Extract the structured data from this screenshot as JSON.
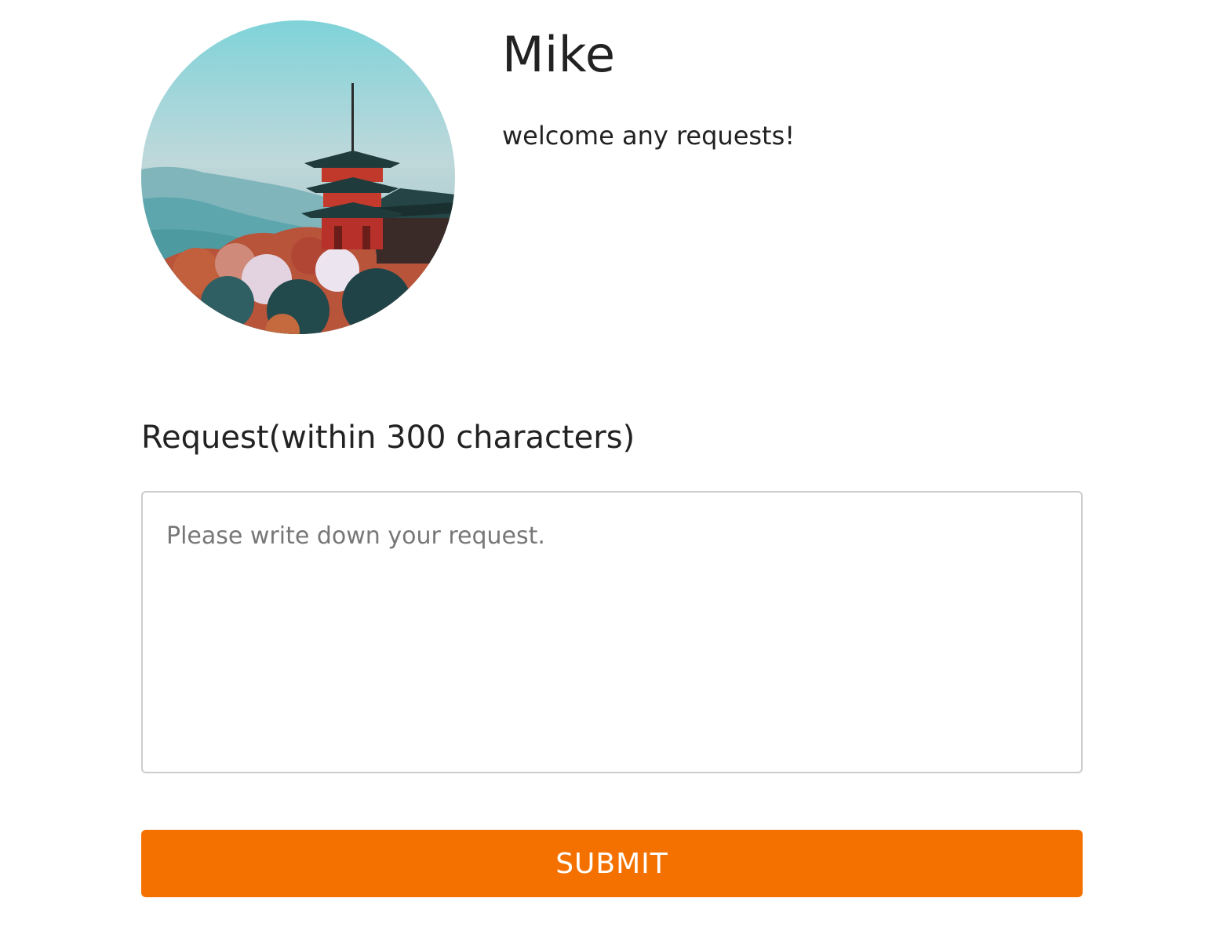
{
  "profile": {
    "name": "Mike",
    "bio": "welcome any requests!",
    "avatar_icon": "pagoda-landscape-photo"
  },
  "request_form": {
    "label": "Request(within 300 characters)",
    "placeholder": "Please write down your request.",
    "value": "",
    "submit_label": "SUBMIT"
  },
  "colors": {
    "accent": "#f47100",
    "text": "#222222",
    "placeholder": "#777777",
    "border": "#cccccc"
  }
}
